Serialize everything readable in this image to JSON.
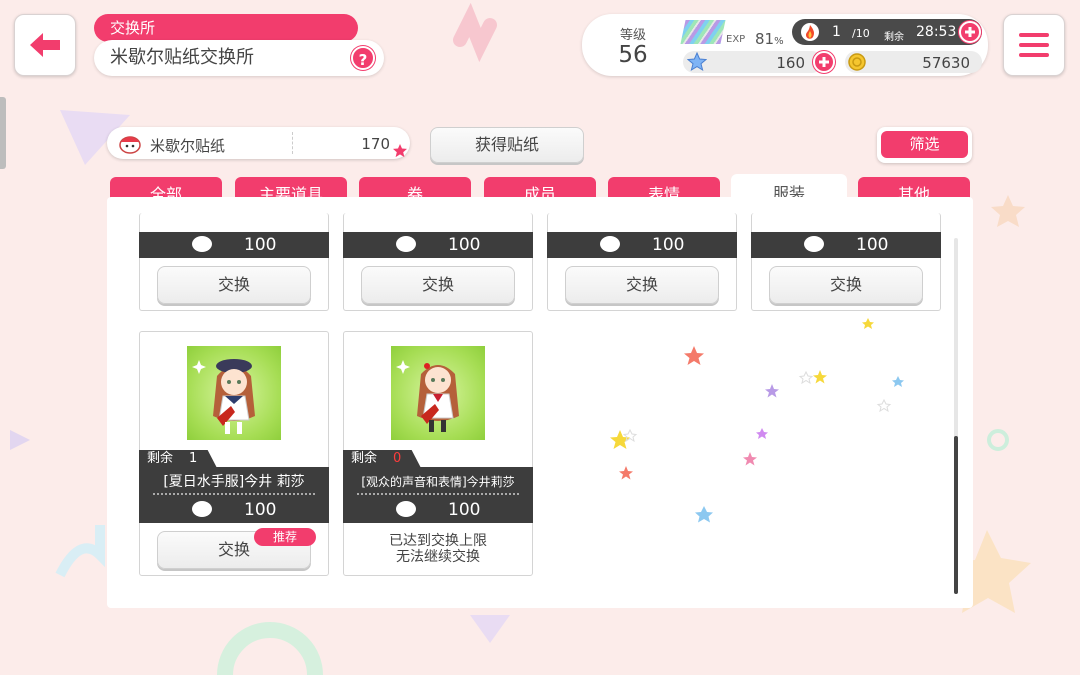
{
  "header": {
    "breadcrumb": "交换所",
    "title": "米歇尔贴纸交换所",
    "help_label": "?",
    "back_icon": "back-arrow-icon",
    "menu_icon": "hamburger-menu-icon"
  },
  "status": {
    "level_label": "等级",
    "level": "56",
    "exp_label": "EXP",
    "exp_percent": "81",
    "exp_unit": "%",
    "stamina_current": "1",
    "stamina_max": "/10",
    "remaining_label": "剩余",
    "stamina_timer": "28:53",
    "star_gems": "160",
    "coins": "57630"
  },
  "currency": {
    "name": "米歇尔贴纸",
    "amount": "170"
  },
  "buttons": {
    "get_stickers": "获得贴纸",
    "filter": "筛选"
  },
  "tabs": [
    {
      "label": "全部",
      "active": false
    },
    {
      "label": "主要道具",
      "active": false
    },
    {
      "label": "券",
      "active": false
    },
    {
      "label": "成员",
      "active": false
    },
    {
      "label": "表情",
      "active": false
    },
    {
      "label": "服装",
      "active": true
    },
    {
      "label": "其他",
      "active": false
    }
  ],
  "top_row": [
    {
      "price": "100",
      "exchange": "交换"
    },
    {
      "price": "100",
      "exchange": "交换"
    },
    {
      "price": "100",
      "exchange": "交换"
    },
    {
      "price": "100",
      "exchange": "交换"
    }
  ],
  "items": [
    {
      "remaining_label": "剩余",
      "remaining": "1",
      "name": "[夏日水手服]今井 莉莎",
      "price": "100",
      "exchange": "交换",
      "badge": "推荐"
    },
    {
      "remaining_label": "剩余",
      "remaining": "0",
      "name": "[观众的声音和表情]今井莉莎",
      "price": "100",
      "limit_line1": "已达到交换上限",
      "limit_line2": "无法继续交换"
    }
  ],
  "colors": {
    "accent": "#f23d6d",
    "background": "#fcecea",
    "dark_bar": "#3d3d3d",
    "remaining_zero": "#ff3c3c"
  },
  "scroll_position": 0.56
}
